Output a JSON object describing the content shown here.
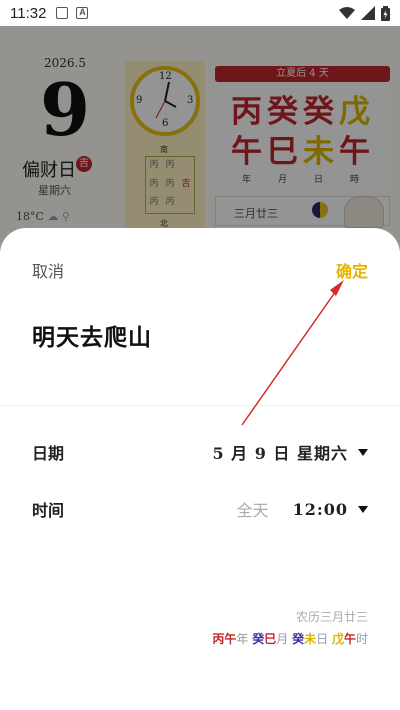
{
  "status_bar": {
    "time": "11:32"
  },
  "background": {
    "year_month": "2026.5",
    "day": "9",
    "fortune": "偏财日",
    "fortune_badge": "吉",
    "weekday": "星期六",
    "temperature": "18°C",
    "clock_numbers": [
      "12",
      "3",
      "6",
      "9"
    ],
    "grid_top_label": "南",
    "grid_bottom_label": "北",
    "grid_cells": [
      "丙",
      "丙",
      "",
      "丙",
      "丙",
      "吉",
      "丙",
      "丙",
      ""
    ],
    "solar_term": "立夏后 4 天",
    "ganzhi_stems": [
      "丙",
      "癸",
      "癸",
      "戊"
    ],
    "ganzhi_branches": [
      "午",
      "巳",
      "未",
      "午"
    ],
    "ganzhi_labels": [
      "年",
      "月",
      "日",
      "時"
    ],
    "ganzhi_colors": [
      "#c0272d",
      "#c0272d",
      "#c0272d",
      "#d9b800"
    ],
    "ganzhi_branch_colors": [
      "#c0272d",
      "#c0272d",
      "#d9b800",
      "#c0272d"
    ],
    "lunar_date": "三月廿三"
  },
  "sheet": {
    "cancel_label": "取消",
    "confirm_label": "确定",
    "event_title": "明天去爬山",
    "date_label": "日期",
    "date_value": "5 月 9 日 星期六",
    "time_label": "时间",
    "allday_label": "全天",
    "time_value": "12:00",
    "lunar_text": "农历三月廿三",
    "ganzhi": [
      {
        "stem": "丙",
        "stem_color": "#c0272d",
        "branch": "午",
        "branch_color": "#c0272d",
        "suffix": "年"
      },
      {
        "stem": "癸",
        "stem_color": "#3a2ea0",
        "branch": "巳",
        "branch_color": "#c0272d",
        "suffix": "月"
      },
      {
        "stem": "癸",
        "stem_color": "#3a2ea0",
        "branch": "未",
        "branch_color": "#d9b800",
        "suffix": "日"
      },
      {
        "stem": "戊",
        "stem_color": "#d9b800",
        "branch": "午",
        "branch_color": "#c0272d",
        "suffix": "时"
      }
    ]
  },
  "colors": {
    "accent": "#e6b400",
    "arrow": "#d42a2a"
  }
}
